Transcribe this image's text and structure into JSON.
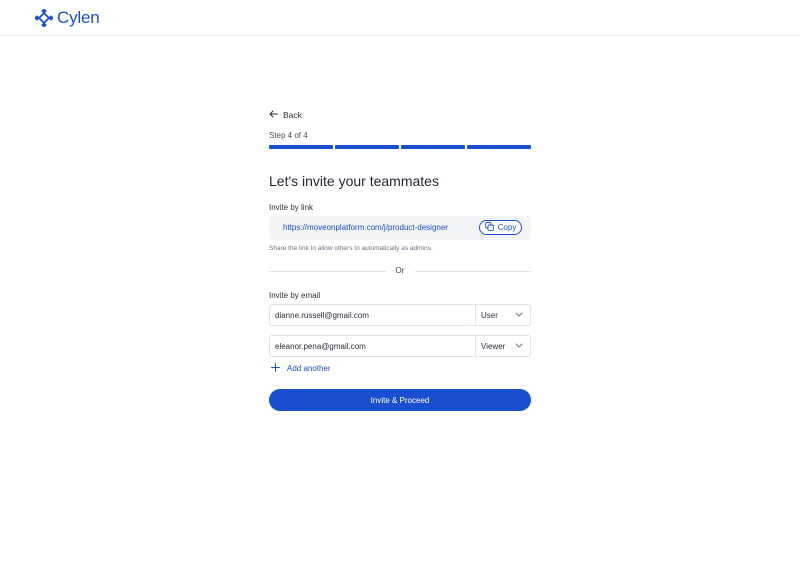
{
  "brand": {
    "name": "Cylen",
    "logo_icon": "cylen-logo-icon",
    "accent": "#1b4fd1"
  },
  "nav": {
    "back_label": "Back",
    "back_icon": "arrow-left-icon"
  },
  "progress": {
    "step_text": "Step 4 of 4",
    "current": 4,
    "total": 4
  },
  "page": {
    "title": "Let's invite your teammates"
  },
  "invite_link": {
    "label": "Invite by link",
    "url": "https://moveonplatform.com/j/product-designer",
    "copy_label": "Copy",
    "copy_icon": "copy-icon",
    "hint": "Share the link to allow others to automatically as admins."
  },
  "divider": {
    "label": "Or"
  },
  "invite_email": {
    "label": "Invite by email",
    "rows": [
      {
        "email": "dianne.russell@gmail.com",
        "role": "User"
      },
      {
        "email": "eleanor.pena@gmail.com",
        "role": "Viewer"
      }
    ],
    "add_label": "Add another",
    "add_icon": "plus-icon"
  },
  "cta": {
    "label": "Invite & Proceed"
  }
}
